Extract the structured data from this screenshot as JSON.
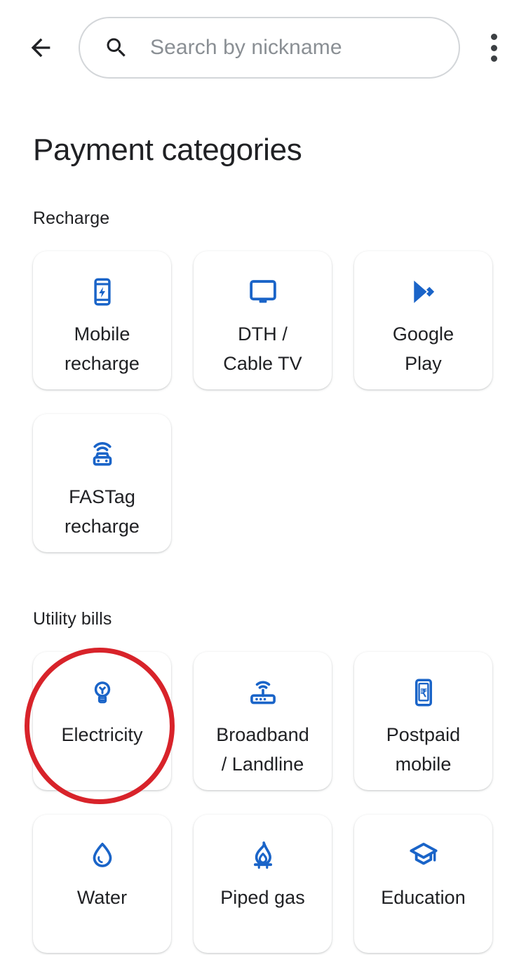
{
  "app": {
    "title": "Payment categories"
  },
  "header": {
    "back_icon": "arrow-back-icon",
    "search": {
      "icon": "search-icon",
      "placeholder": "Search by nickname",
      "value": ""
    },
    "overflow_icon": "more-vert-icon"
  },
  "sections": [
    {
      "id": "recharge",
      "label": "Recharge",
      "items": [
        {
          "label": "Mobile\nrecharge",
          "icon": "mobile-recharge-icon"
        },
        {
          "label": "DTH /\nCable TV",
          "icon": "tv-icon"
        },
        {
          "label": "Google\nPlay",
          "icon": "google-play-icon"
        },
        {
          "label": "FASTag\nrecharge",
          "icon": "fastag-car-icon"
        }
      ]
    },
    {
      "id": "utility",
      "label": "Utility bills",
      "items": [
        {
          "label": "Electricity",
          "icon": "lightbulb-icon"
        },
        {
          "label": "Broadband\n/ Landline",
          "icon": "router-icon"
        },
        {
          "label": "Postpaid\nmobile",
          "icon": "phone-rupee-icon"
        },
        {
          "label": "Water",
          "icon": "water-drop-icon"
        },
        {
          "label": "Piped gas",
          "icon": "gas-flame-icon"
        },
        {
          "label": "Education",
          "icon": "graduation-cap-icon"
        }
      ]
    }
  ],
  "annotation": {
    "type": "circle-highlight",
    "target": "Electricity",
    "color": "#d8232a"
  },
  "colors": {
    "icon_blue": "#1a64c8",
    "text_primary": "#202124",
    "placeholder": "#8a8f94",
    "background": "#ffffff",
    "annotation_red": "#d8232a"
  }
}
